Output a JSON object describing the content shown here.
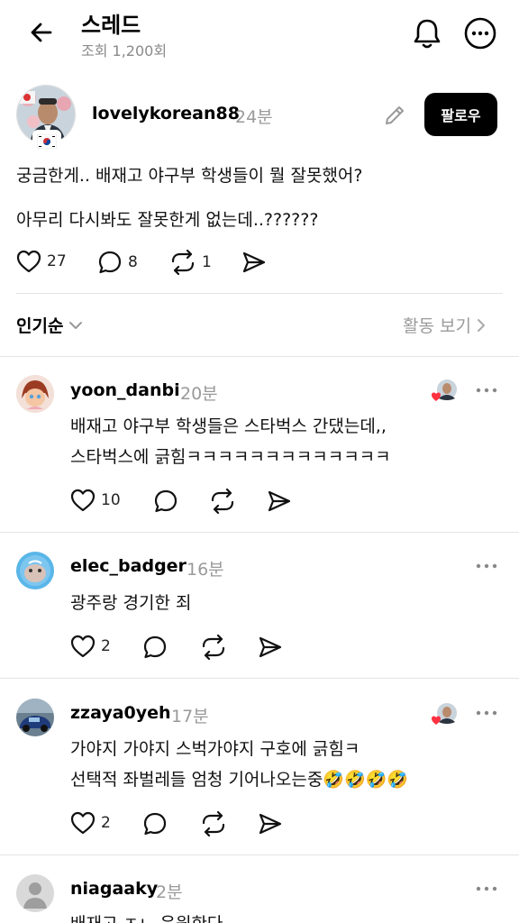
{
  "header": {
    "title": "스레드",
    "subtitle": "조회 1,200회"
  },
  "post": {
    "username": "lovelykorean88",
    "time": "24분",
    "follow_label": "팔로우",
    "lines": [
      "궁금한게.. 배재고 야구부 학생들이 뭘 잘못했어?",
      "아무리 다시봐도 잘못한게 없는데..??????"
    ],
    "likes": "27",
    "comments": "8",
    "reposts": "1"
  },
  "sort": {
    "label": "인기순",
    "activity_label": "활동 보기"
  },
  "comments": [
    {
      "username": "yoon_danbi",
      "time": "20분",
      "lines": [
        "배재고 야구부 학생들은 스타벅스 간댔는데,,",
        "스타벅스에 긁힘ㅋㅋㅋㅋㅋㅋㅋㅋㅋㅋㅋㅋㅋ"
      ],
      "likes": "10",
      "liked_by_op": true
    },
    {
      "username": "elec_badger",
      "time": "16분",
      "lines": [
        "광주랑 경기한 죄"
      ],
      "likes": "2",
      "liked_by_op": false
    },
    {
      "username": "zzaya0yeh",
      "time": "17분",
      "lines": [
        "가야지 가야지 스벅가야지  구호에 긁힘ㅋ",
        "선택적 좌벌레들 엄청 기어나오는중🤣🤣🤣🤣"
      ],
      "likes": "2",
      "liked_by_op": true
    },
    {
      "username": "niagaaky",
      "time": "2분",
      "lines": [
        "배재고 ㅈㄴ 응원한다"
      ],
      "likes": "",
      "liked_by_op": false
    }
  ],
  "icons": {
    "back": "arrow-left-icon",
    "bell": "bell-icon",
    "more": "more-circle-icon",
    "edit": "pencil-icon",
    "like": "heart-icon",
    "comment": "comment-bubble-icon",
    "repost": "repost-icon",
    "share": "send-icon"
  }
}
